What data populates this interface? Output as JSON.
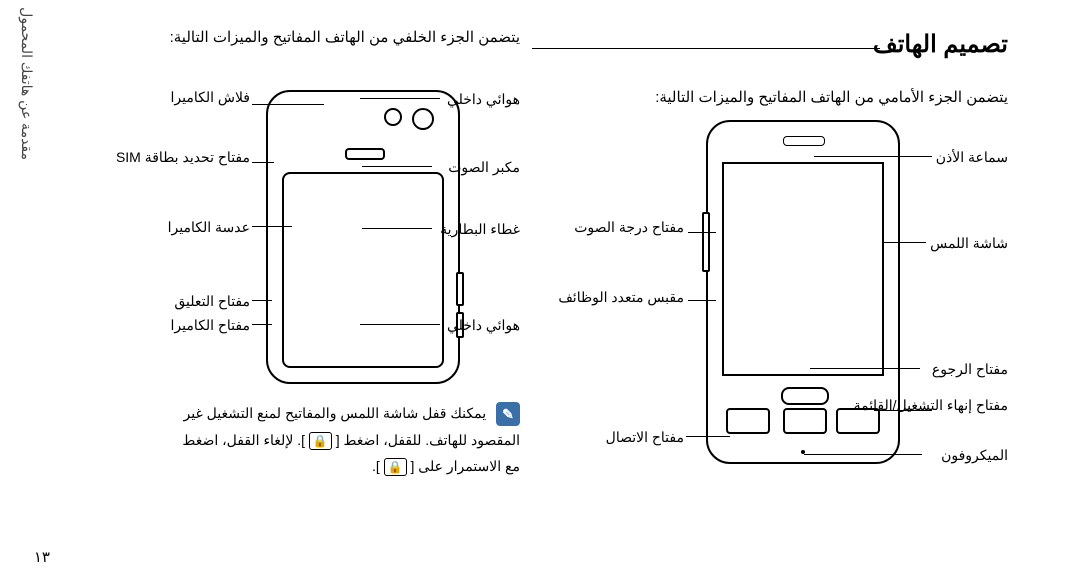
{
  "side_tab": "مقدمة عن هاتفك المحمول",
  "title": "تصميم الهاتف",
  "front": {
    "caption": "يتضمن الجزء الأمامي من الهاتف المفاتيح والميزات التالية:",
    "labels": {
      "earpiece": "سماعة الأذن",
      "touchscreen": "شاشة اللمس",
      "back_key": "مفتاح الرجوع",
      "end_power_menu": "مفتاح إنهاء التشغيل/القائمة",
      "microphone": "الميكروفون",
      "volume_key": "مفتاح درجة الصوت",
      "multi_jog": "مقبس متعدد الوظائف",
      "dial_key": "مفتاح الاتصال"
    }
  },
  "back": {
    "caption": "يتضمن الجزء الخلفي من الهاتف المفاتيح والميزات التالية:",
    "labels": {
      "internal_antenna_top": "هوائي داخلي",
      "loudspeaker": "مكبر الصوت",
      "battery_cover": "غطاء البطارية",
      "internal_antenna_bottom": "هوائي داخلي",
      "camera_flash": "فلاش الكاميرا",
      "sim_detect_key": "مفتاح تحديد بطاقة SIM",
      "camera_lens": "عدسة الكاميرا",
      "hold_key": "مفتاح التعليق",
      "camera_key": "مفتاح الكاميرا"
    }
  },
  "note": {
    "line1_a": "يمكنك قفل شاشة اللمس والمفاتيح لمنع التشغيل غير",
    "line1_b": "المقصود للهاتف. للقفل، اضغط [",
    "line1_c": "]. لإلغاء القفل، اضغط",
    "line2_a": "مع الاستمرار على [",
    "line2_b": "]."
  },
  "page_number": "١٣"
}
